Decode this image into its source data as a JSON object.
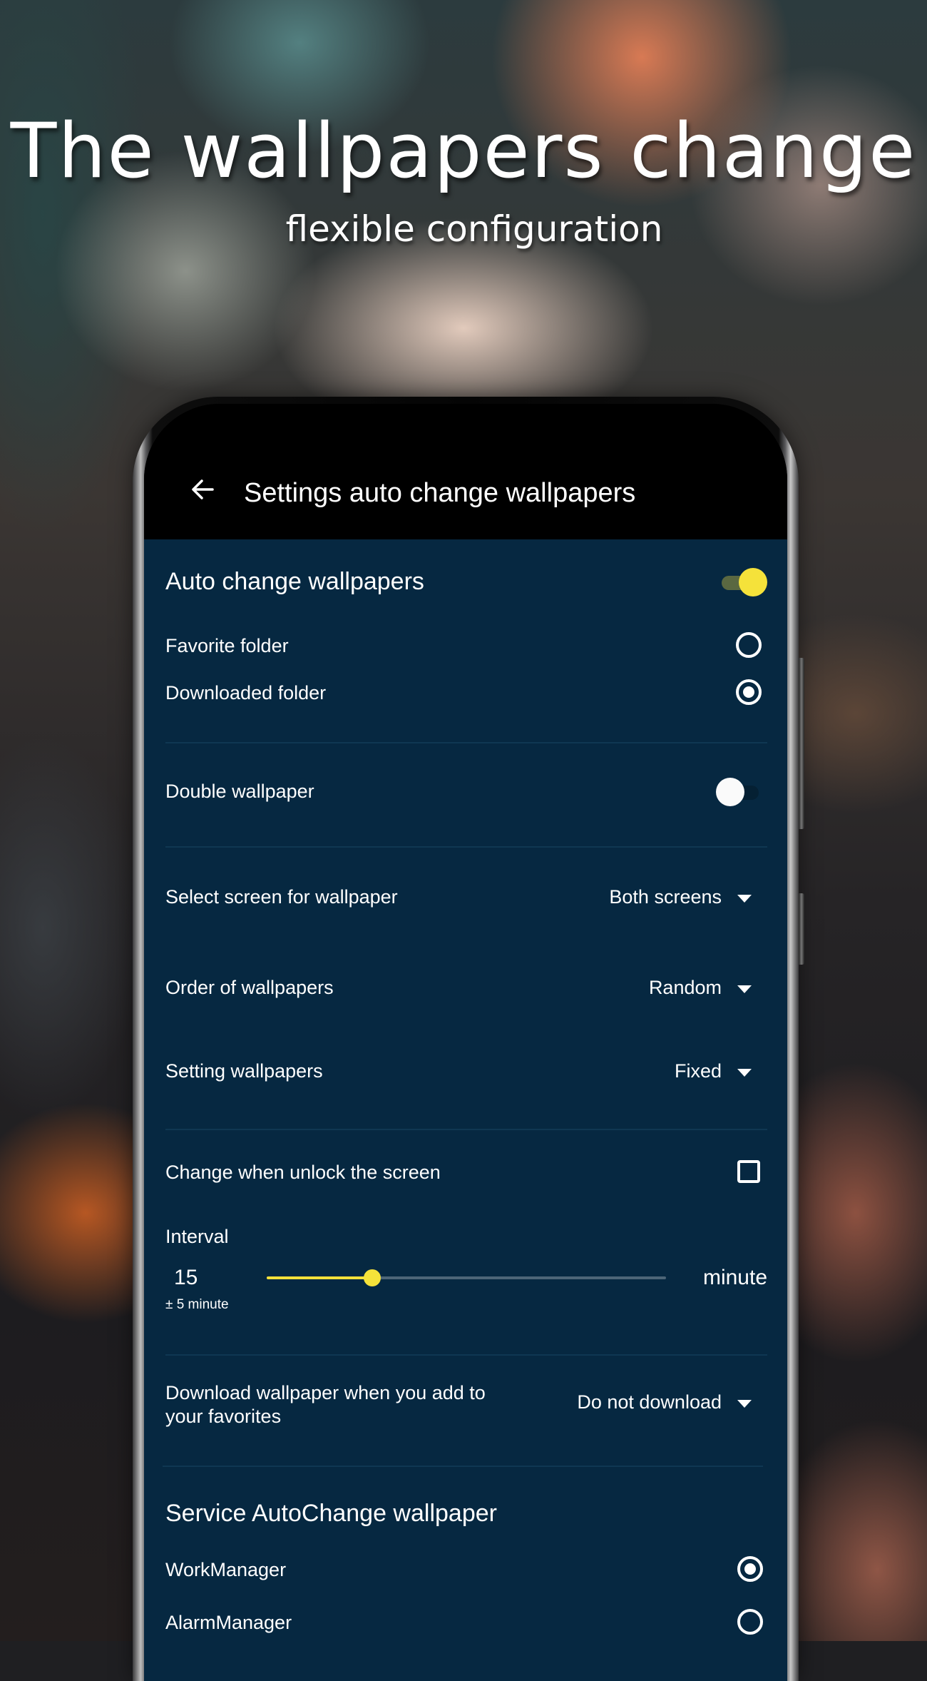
{
  "promo": {
    "headline": "The wallpapers change",
    "subheadline": "flexible configuration"
  },
  "appbar": {
    "back_icon": "arrow-left-icon",
    "title": "Settings auto change wallpapers"
  },
  "colors": {
    "accent": "#f5e23a",
    "screen_bg": "#062841",
    "appbar_bg": "#000000",
    "text": "#ffffff"
  },
  "settings": {
    "auto_change": {
      "label": "Auto change wallpapers",
      "on": true
    },
    "source_folders": [
      {
        "label": "Favorite folder",
        "checked": false
      },
      {
        "label": "Downloaded folder",
        "checked": true
      }
    ],
    "double_wallpaper": {
      "label": "Double wallpaper",
      "on": false
    },
    "select_screen": {
      "label": "Select screen for wallpaper",
      "value": "Both screens"
    },
    "order": {
      "label": "Order of wallpapers",
      "value": "Random"
    },
    "setting_mode": {
      "label": "Setting wallpapers",
      "value": "Fixed"
    },
    "change_on_unlock": {
      "label": "Change when unlock the screen",
      "checked": false
    },
    "interval": {
      "label": "Interval",
      "value": "15",
      "tolerance": "± 5 minute",
      "unit": "minute",
      "slider_fraction": 0.265
    },
    "download_on_favorite": {
      "label": "Download wallpaper when you add to your favorites",
      "value": "Do not download"
    },
    "service": {
      "title": "Service AutoChange wallpaper",
      "options": [
        {
          "label": "WorkManager",
          "checked": true
        },
        {
          "label": "AlarmManager",
          "checked": false
        }
      ]
    }
  }
}
